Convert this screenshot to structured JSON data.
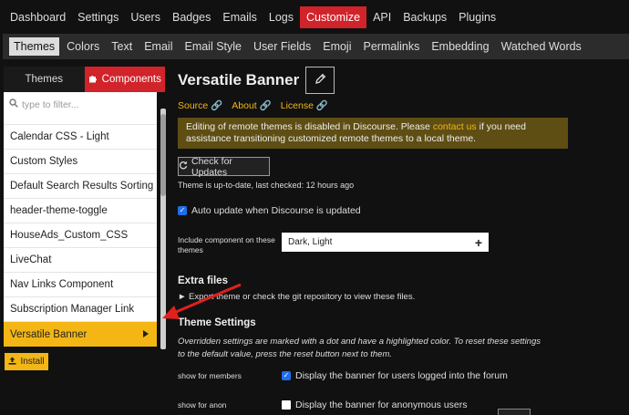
{
  "topnav": {
    "items": [
      "Dashboard",
      "Settings",
      "Users",
      "Badges",
      "Emails",
      "Logs",
      "Customize",
      "API",
      "Backups",
      "Plugins"
    ],
    "active": "Customize"
  },
  "subnav": {
    "items": [
      "Themes",
      "Colors",
      "Text",
      "Email",
      "Email Style",
      "User Fields",
      "Emoji",
      "Permalinks",
      "Embedding",
      "Watched Words"
    ],
    "active": "Themes"
  },
  "sidebar": {
    "tab_themes": "Themes",
    "tab_components": "Components",
    "filter_placeholder": "type to filter...",
    "items": [
      "Calendar CSS - Light",
      "Custom Styles",
      "Default Search Results Sorting",
      "header-theme-toggle",
      "HouseAds_Custom_CSS",
      "LiveChat",
      "Nav Links Component",
      "Subscription Manager Link",
      "Versatile Banner"
    ],
    "selected": "Versatile Banner",
    "install_label": "Install"
  },
  "main": {
    "title": "Versatile Banner",
    "links": [
      "Source",
      "About",
      "License"
    ],
    "notice_before": "Editing of remote themes is disabled in Discourse. Please ",
    "notice_link": "contact us",
    "notice_after": " if you need assistance transitioning customized remote themes to a local theme.",
    "check_updates_label": "Check for Updates",
    "up_to_date": "Theme is up-to-date, last checked: 12 hours ago",
    "auto_update_label": "Auto update when Discourse is updated",
    "auto_update_checked": true,
    "include_label": "Include component on these themes",
    "include_value": "Dark, Light",
    "extra_files_heading": "Extra files",
    "extra_files_text": "Export theme or check the git repository to view these files.",
    "theme_settings_heading": "Theme Settings",
    "theme_settings_desc": "Overridden settings are marked with a dot and have a highlighted color. To reset these settings to the default value, press the reset button next to them.",
    "settings": [
      {
        "label": "show for members",
        "description": "Display the banner for users logged into the forum",
        "checked": true
      },
      {
        "label": "show for anon",
        "description": "Display the banner for anonymous users",
        "checked": false
      }
    ]
  },
  "colors": {
    "accent_red": "#d1232a",
    "accent_yellow": "#f3b615",
    "notice_bg": "#5f4e14",
    "background": "#111111"
  },
  "icons": [
    "puzzle-icon",
    "search-icon",
    "pencil-icon",
    "link-icon",
    "refresh-icon",
    "upload-icon",
    "chevron-right-icon",
    "caret-right-icon",
    "plus-icon"
  ]
}
